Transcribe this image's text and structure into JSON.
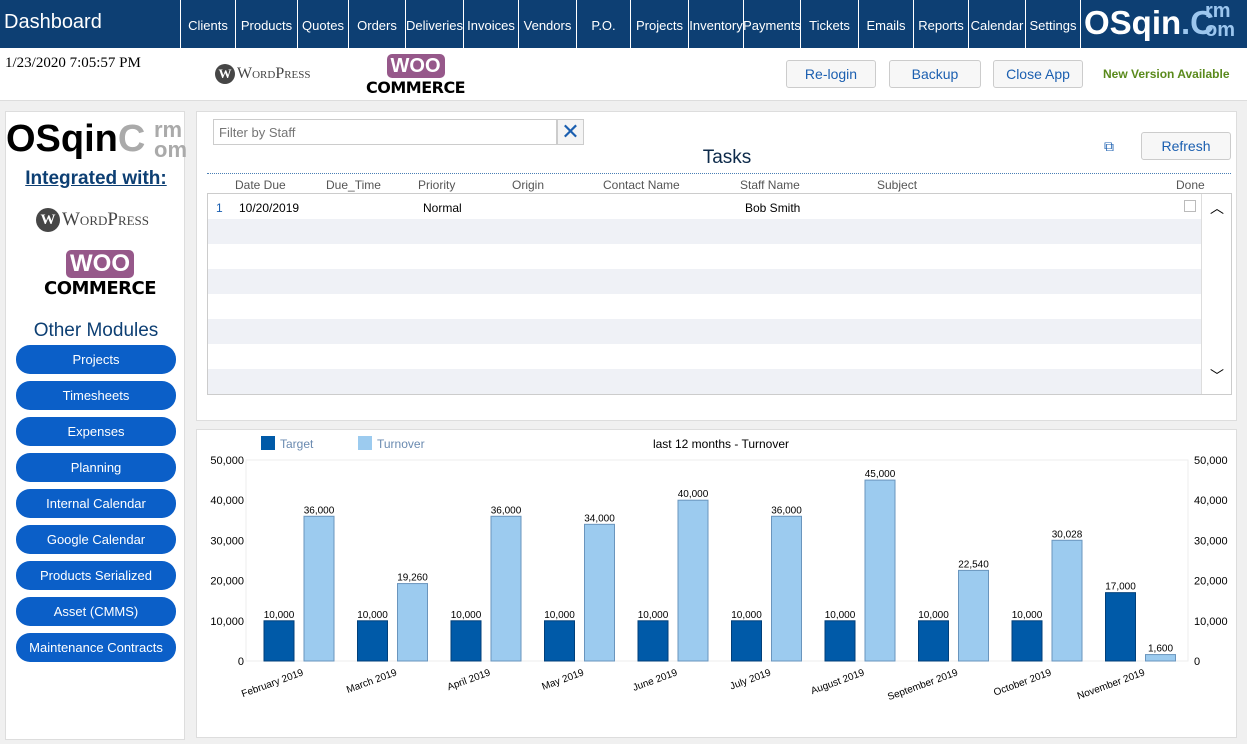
{
  "header": {
    "title": "Dashboard",
    "nav": [
      "Clients",
      "Products",
      "Quotes",
      "Orders",
      "Deliveries",
      "Invoices",
      "Vendors",
      "P.O.",
      "Projects",
      "Inventory",
      "Payments",
      "Tickets",
      "Emails",
      "Reports",
      "Calendar",
      "Settings"
    ],
    "logo": "OSqin.Crm.com"
  },
  "subbar": {
    "datetime": "1/23/2020 7:05:57 PM",
    "wordpress": "WordPress",
    "woo": "WOO",
    "commerce": "COMMERCE",
    "relogin": "Re-login",
    "backup": "Backup",
    "close": "Close App",
    "new_version": "New Version Available"
  },
  "sidebar": {
    "logo_main": "OSqin",
    "logo_c": "C",
    "logo_rm": "rm",
    "logo_om": "om",
    "integrated": "Integrated with:",
    "wordpress": "WordPress",
    "woo": "WOO",
    "commerce": "COMMERCE",
    "other_modules": "Other Modules",
    "modules": [
      "Projects",
      "Timesheets",
      "Expenses",
      "Planning",
      "Internal Calendar",
      "Google Calendar",
      "Products Serialized",
      "Asset (CMMS)",
      "Maintenance Contracts"
    ]
  },
  "tasks": {
    "filter_placeholder": "Filter by Staff",
    "title": "Tasks",
    "refresh": "Refresh",
    "columns": [
      "Date Due",
      "Due_Time",
      "Priority",
      "Origin",
      "Contact Name",
      "Staff Name",
      "Subject",
      "Done"
    ],
    "rows": [
      {
        "num": "1",
        "date_due": "10/20/2019",
        "due_time": "",
        "priority": "Normal",
        "origin": "",
        "contact": "",
        "staff": "Bob Smith",
        "subject": "",
        "done": false
      }
    ]
  },
  "colors": {
    "header": "#0d3f73",
    "target": "#005aa8",
    "turnover": "#9ccbef",
    "module_button": "#0b5fc8"
  },
  "chart_data": {
    "type": "bar",
    "title": "last 12 months - Turnover",
    "categories": [
      "February 2019",
      "March 2019",
      "April 2019",
      "May 2019",
      "June 2019",
      "July 2019",
      "August 2019",
      "September 2019",
      "October 2019",
      "November 2019"
    ],
    "series": [
      {
        "name": "Target",
        "values": [
          10000,
          10000,
          10000,
          10000,
          10000,
          10000,
          10000,
          10000,
          10000,
          17000
        ]
      },
      {
        "name": "Turnover",
        "values": [
          36000,
          19260,
          36000,
          34000,
          40000,
          36000,
          45000,
          22540,
          30028,
          1600
        ]
      }
    ],
    "ylim": [
      0,
      50000
    ],
    "yticks": [
      "0",
      "10,000",
      "20,000",
      "30,000",
      "40,000",
      "50,000"
    ],
    "legend": "top-left",
    "dual_axis": true
  }
}
